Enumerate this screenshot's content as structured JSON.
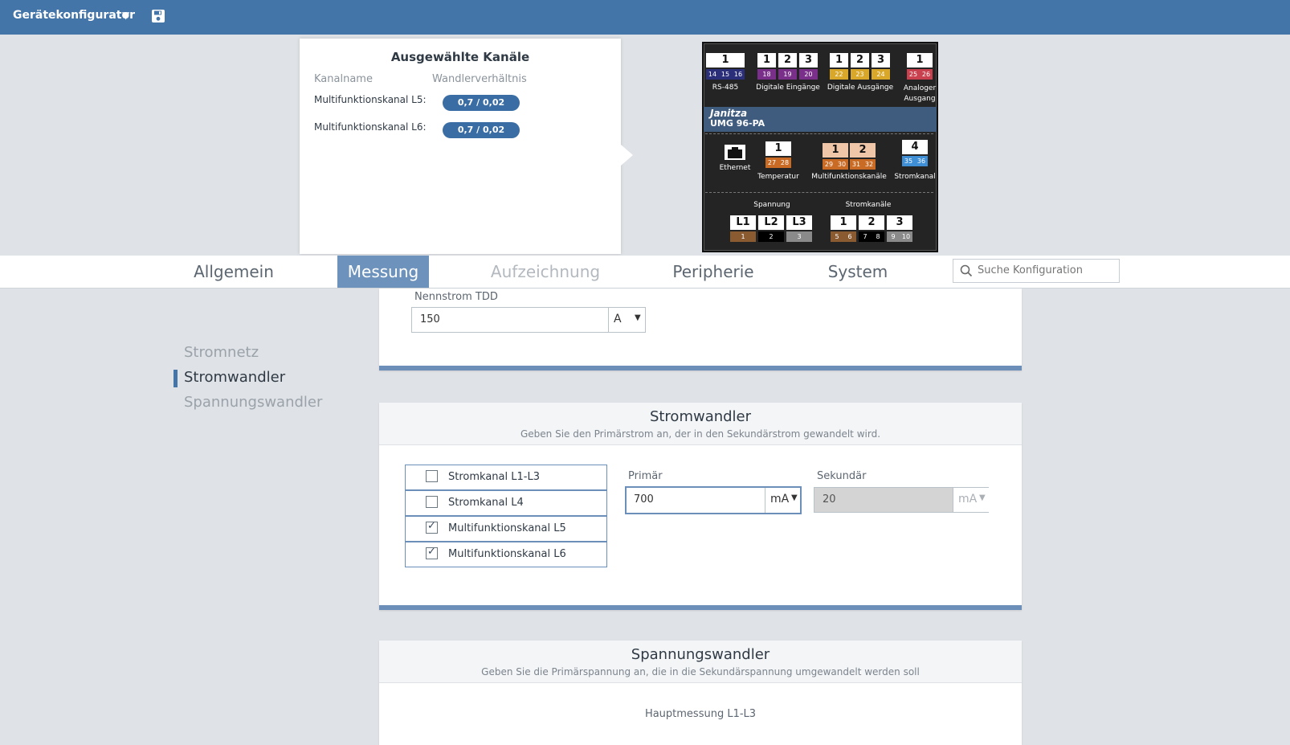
{
  "header": {
    "app_title": "Gerätekonfigurator",
    "save_icon": "floppy-disk-icon",
    "bg_color": "#4475a9"
  },
  "popup": {
    "title": "Ausgewählte Kanäle",
    "col_name": "Kanalname",
    "col_ratio": "Wandlerverhältnis",
    "rows": [
      {
        "label": "Multifunktionskanal L5:",
        "value": "0,7 / 0,02"
      },
      {
        "label": "Multifunktionskanal L6:",
        "value": "0,7 / 0,02"
      }
    ]
  },
  "device": {
    "brand": "Janitza",
    "model": "UMG 96-PA",
    "top_groups": [
      {
        "label": "RS-485",
        "terms": [
          "1"
        ],
        "pins": [
          "14",
          "15",
          "16"
        ]
      },
      {
        "label": "Digitale Eingänge",
        "terms": [
          "1",
          "2",
          "3"
        ],
        "pins": [
          "18",
          "19",
          "20"
        ]
      },
      {
        "label": "Digitale Ausgänge",
        "terms": [
          "1",
          "2",
          "3"
        ],
        "pins": [
          "22",
          "23",
          "24"
        ]
      },
      {
        "label": "Analoger Ausgang",
        "terms": [
          "1"
        ],
        "pins": [
          "25",
          "26"
        ]
      }
    ],
    "mid_groups": [
      {
        "label": "Ethernet"
      },
      {
        "label": "Temperatur",
        "terms": [
          "1"
        ],
        "pins": [
          "27",
          "28"
        ]
      },
      {
        "label": "Multifunktionskanäle",
        "terms": [
          "1",
          "2"
        ],
        "pins": [
          "29",
          "30",
          "31",
          "32"
        ]
      },
      {
        "label": "Stromkanal",
        "terms": [
          "4"
        ],
        "pins": [
          "35",
          "36"
        ]
      }
    ],
    "bottom_groups": [
      {
        "label": "Spannung",
        "terms": [
          "L1",
          "L2",
          "L3"
        ],
        "pins": [
          "1",
          "2",
          "3"
        ]
      },
      {
        "label": "Stromkanäle",
        "terms": [
          "1",
          "2",
          "3"
        ],
        "pins": [
          "5",
          "6",
          "7",
          "8",
          "9",
          "10"
        ]
      }
    ]
  },
  "tabs": [
    {
      "label": "Allgemein",
      "state": "normal"
    },
    {
      "label": "Messung",
      "state": "active"
    },
    {
      "label": "Aufzeichnung",
      "state": "disabled"
    },
    {
      "label": "Peripherie",
      "state": "normal"
    },
    {
      "label": "System",
      "state": "normal"
    }
  ],
  "search": {
    "placeholder": "Suche Konfiguration",
    "icon": "search-icon"
  },
  "side_nav": {
    "items": [
      {
        "label": "Stromnetz",
        "active": false
      },
      {
        "label": "Stromwandler",
        "active": true
      },
      {
        "label": "Spannungswandler",
        "active": false
      }
    ]
  },
  "nennstrom": {
    "label": "Nennstrom TDD",
    "value": "150",
    "unit": "A"
  },
  "stromwandler": {
    "title": "Stromwandler",
    "subtitle": "Geben Sie den Primärstrom an, der in den Sekundärstrom gewandelt wird.",
    "channels": [
      {
        "label": "Stromkanal L1-L3",
        "checked": false
      },
      {
        "label": "Stromkanal L4",
        "checked": false
      },
      {
        "label": "Multifunktionskanal L5",
        "checked": true
      },
      {
        "label": "Multifunktionskanal L6",
        "checked": true
      }
    ],
    "primary": {
      "label": "Primär",
      "value": "700",
      "unit": "mA"
    },
    "secondary": {
      "label": "Sekundär",
      "value": "20",
      "unit": "mA"
    }
  },
  "spannungswandler": {
    "title": "Spannungswandler",
    "subtitle": "Geben Sie die Primärspannung an, die in die Sekundärspannung umgewandelt werden soll",
    "section_label": "Hauptmessung L1-L3"
  }
}
